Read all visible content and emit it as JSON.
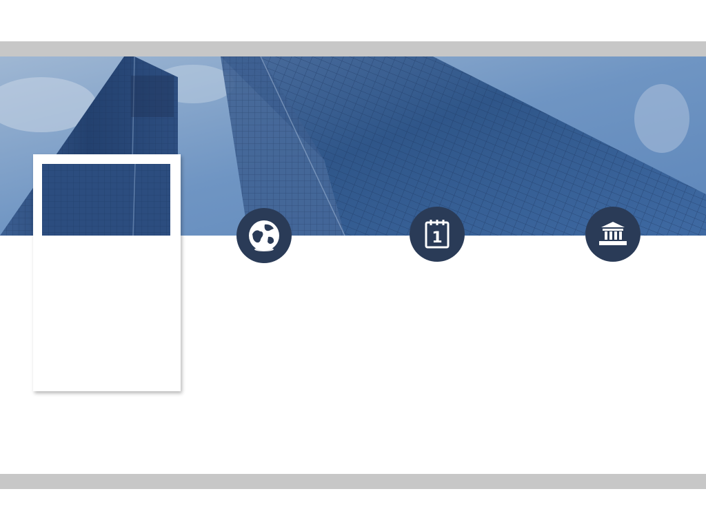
{
  "slide": {
    "background": "#ffffff",
    "bar_color": "#c7c7c7",
    "icon_circle_color": "#2a3b57"
  },
  "banner": {
    "image": "skyscraper-glass-towers-photo",
    "sky_color": "#6d92bf"
  },
  "photo_frame": {
    "image": "tower-detail-photo"
  },
  "icons": [
    {
      "name": "globe-icon"
    },
    {
      "name": "calendar-icon",
      "text": "1"
    },
    {
      "name": "bank-icon"
    }
  ]
}
